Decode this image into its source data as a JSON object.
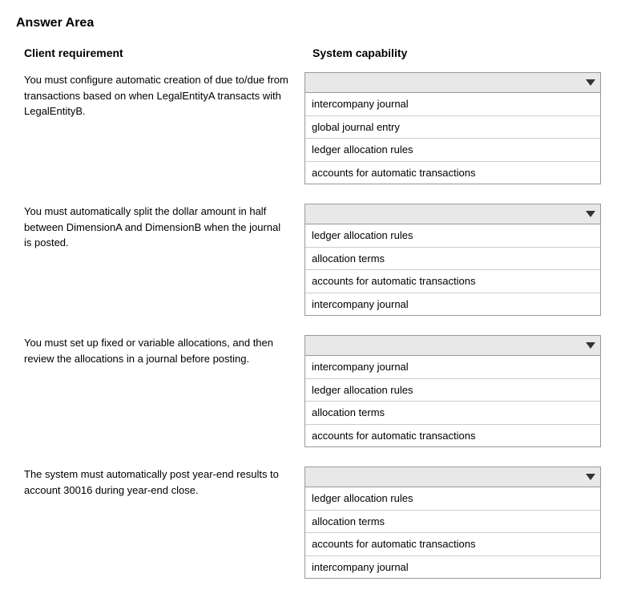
{
  "page": {
    "title": "Answer Area",
    "columns": {
      "requirement": "Client requirement",
      "capability": "System capability"
    }
  },
  "rows": [
    {
      "id": "row1",
      "requirement": "You must configure automatic creation of due to/due from transactions based on when LegalEntityA transacts with LegalEntityB.",
      "dropdown_placeholder": "",
      "options": [
        "intercompany journal",
        "global journal entry",
        "ledger allocation rules",
        "accounts for automatic transactions"
      ]
    },
    {
      "id": "row2",
      "requirement": "You must automatically split the dollar amount in half between DimensionA and DimensionB when the journal is posted.",
      "dropdown_placeholder": "",
      "options": [
        "ledger allocation rules",
        "allocation terms",
        "accounts for automatic transactions",
        "intercompany journal"
      ]
    },
    {
      "id": "row3",
      "requirement": "You must set up fixed or variable allocations, and then review the allocations in a journal before posting.",
      "dropdown_placeholder": "",
      "options": [
        "intercompany journal",
        "ledger allocation rules",
        "allocation terms",
        "accounts for automatic transactions"
      ]
    },
    {
      "id": "row4",
      "requirement": "The system must automatically post year-end results to account 30016 during year-end close.",
      "dropdown_placeholder": "",
      "options": [
        "ledger allocation rules",
        "allocation terms",
        "accounts for automatic transactions",
        "intercompany journal"
      ]
    }
  ]
}
